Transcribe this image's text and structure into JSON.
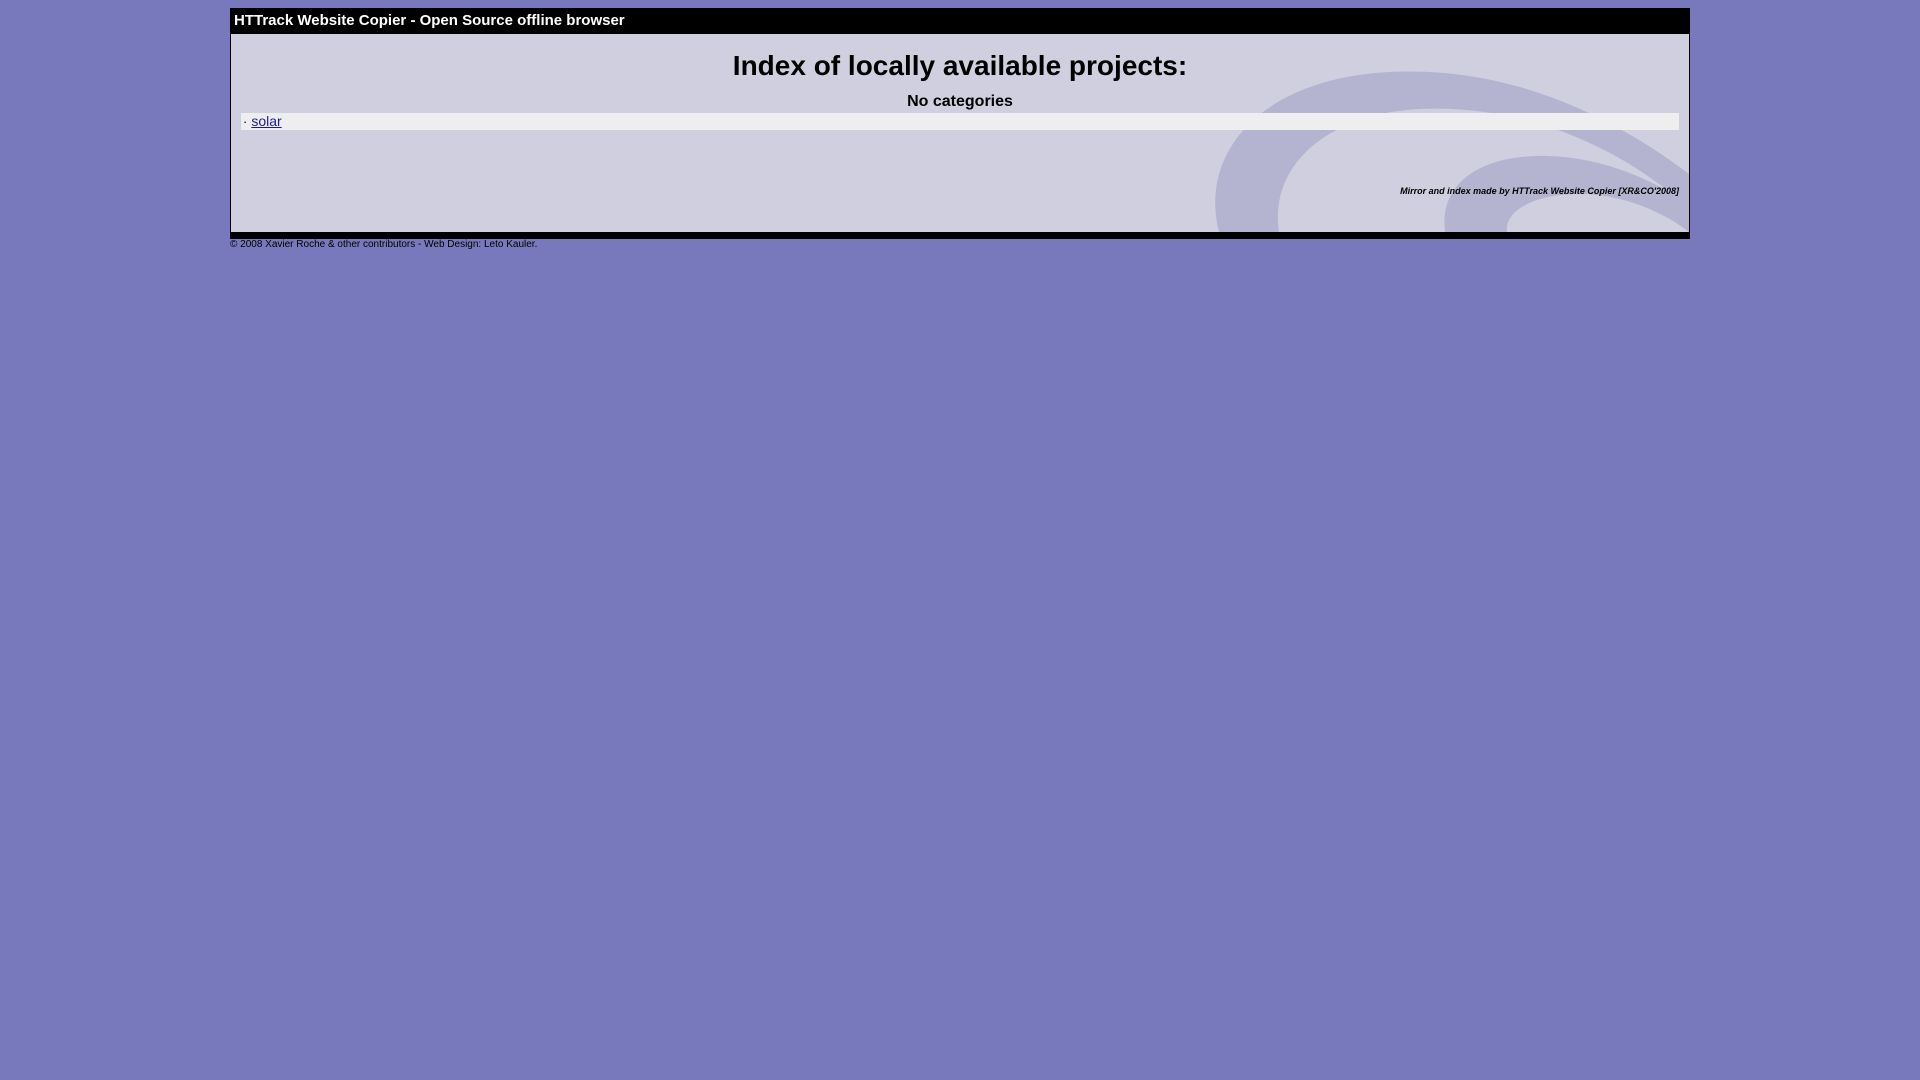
{
  "header": {
    "title": "HTTrack Website Copier - Open Source offline browser"
  },
  "main": {
    "heading": "Index of locally available projects:",
    "subheading": "No categories",
    "projects": [
      {
        "bullet": "·",
        "label": "solar"
      }
    ],
    "credit": "Mirror and index made by HTTrack Website Copier [XR&CO'2008]"
  },
  "footer": {
    "text": "© 2008 Xavier Roche & other contributors - Web Design: Leto Kauler."
  },
  "colors": {
    "page_background": "#7878bc",
    "panel_background": "#cfcfe0",
    "title_bar": "#000000",
    "link": "#1a1aa6",
    "project_row": "#eeeeee"
  }
}
